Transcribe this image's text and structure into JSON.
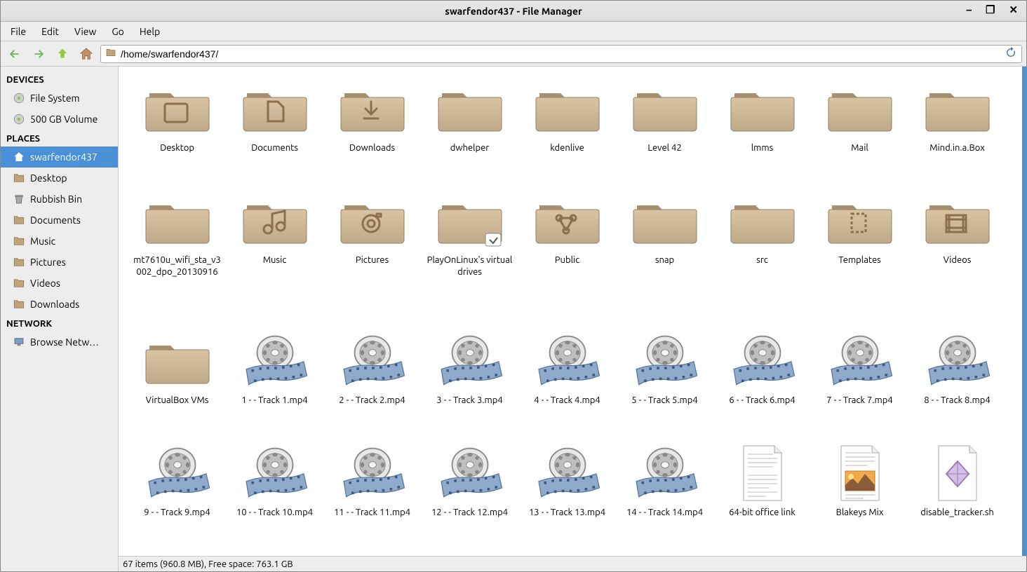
{
  "window": {
    "title": "swarfendor437 - File Manager"
  },
  "menu": {
    "file": "File",
    "edit": "Edit",
    "view": "View",
    "go": "Go",
    "help": "Help"
  },
  "toolbar": {
    "path": "/home/swarfendor437/"
  },
  "sidebar": {
    "devices_hdr": "DEVICES",
    "devices": [
      {
        "label": "File System",
        "icon": "drive"
      },
      {
        "label": "500 GB Volume",
        "icon": "drive"
      }
    ],
    "places_hdr": "PLACES",
    "places": [
      {
        "label": "swarfendor437",
        "icon": "home",
        "selected": true
      },
      {
        "label": "Desktop",
        "icon": "folder"
      },
      {
        "label": "Rubbish Bin",
        "icon": "trash"
      },
      {
        "label": "Documents",
        "icon": "folder"
      },
      {
        "label": "Music",
        "icon": "folder"
      },
      {
        "label": "Pictures",
        "icon": "folder"
      },
      {
        "label": "Videos",
        "icon": "folder"
      },
      {
        "label": "Downloads",
        "icon": "folder"
      }
    ],
    "network_hdr": "NETWORK",
    "network": [
      {
        "label": "Browse Netw…",
        "icon": "network"
      }
    ]
  },
  "items": [
    {
      "label": "Desktop",
      "type": "folder",
      "glyph": "desktop"
    },
    {
      "label": "Documents",
      "type": "folder",
      "glyph": "doc"
    },
    {
      "label": "Downloads",
      "type": "folder",
      "glyph": "download"
    },
    {
      "label": "dwhelper",
      "type": "folder"
    },
    {
      "label": "kdenlive",
      "type": "folder"
    },
    {
      "label": "Level 42",
      "type": "folder"
    },
    {
      "label": "lmms",
      "type": "folder"
    },
    {
      "label": "Mail",
      "type": "folder"
    },
    {
      "label": "Mind.in.a.Box",
      "type": "folder"
    },
    {
      "label": "mt7610u_wifi_sta_v3002_dpo_20130916",
      "type": "folder"
    },
    {
      "label": "Music",
      "type": "folder",
      "glyph": "music"
    },
    {
      "label": "Pictures",
      "type": "folder",
      "glyph": "pictures"
    },
    {
      "label": "PlayOnLinux's virtual drives",
      "type": "folder",
      "link": true
    },
    {
      "label": "Public",
      "type": "folder",
      "glyph": "public"
    },
    {
      "label": "snap",
      "type": "folder"
    },
    {
      "label": "src",
      "type": "folder"
    },
    {
      "label": "Templates",
      "type": "folder",
      "glyph": "templates"
    },
    {
      "label": "Videos",
      "type": "folder",
      "glyph": "videos"
    },
    {
      "label": "VirtualBox VMs",
      "type": "folder"
    },
    {
      "label": "1 - - Track 1.mp4",
      "type": "video"
    },
    {
      "label": "2 - - Track 2.mp4",
      "type": "video"
    },
    {
      "label": "3 - - Track 3.mp4",
      "type": "video"
    },
    {
      "label": "4 - - Track 4.mp4",
      "type": "video"
    },
    {
      "label": "5 - - Track 5.mp4",
      "type": "video"
    },
    {
      "label": "6 - - Track 6.mp4",
      "type": "video"
    },
    {
      "label": "7 - - Track 7.mp4",
      "type": "video"
    },
    {
      "label": "8 - - Track 8.mp4",
      "type": "video"
    },
    {
      "label": "9 - - Track 9.mp4",
      "type": "video"
    },
    {
      "label": "10 - - Track 10.mp4",
      "type": "video"
    },
    {
      "label": "11 - - Track 11.mp4",
      "type": "video"
    },
    {
      "label": "12 - - Track 12.mp4",
      "type": "video"
    },
    {
      "label": "13 - - Track 13.mp4",
      "type": "video"
    },
    {
      "label": "14 - - Track 14.mp4",
      "type": "video"
    },
    {
      "label": "64-bit office link",
      "type": "doc"
    },
    {
      "label": "Blakeys Mix",
      "type": "doc-img"
    },
    {
      "label": "disable_tracker.sh",
      "type": "script"
    }
  ],
  "status": "67 items (960.8 MB), Free space: 763.1 GB"
}
